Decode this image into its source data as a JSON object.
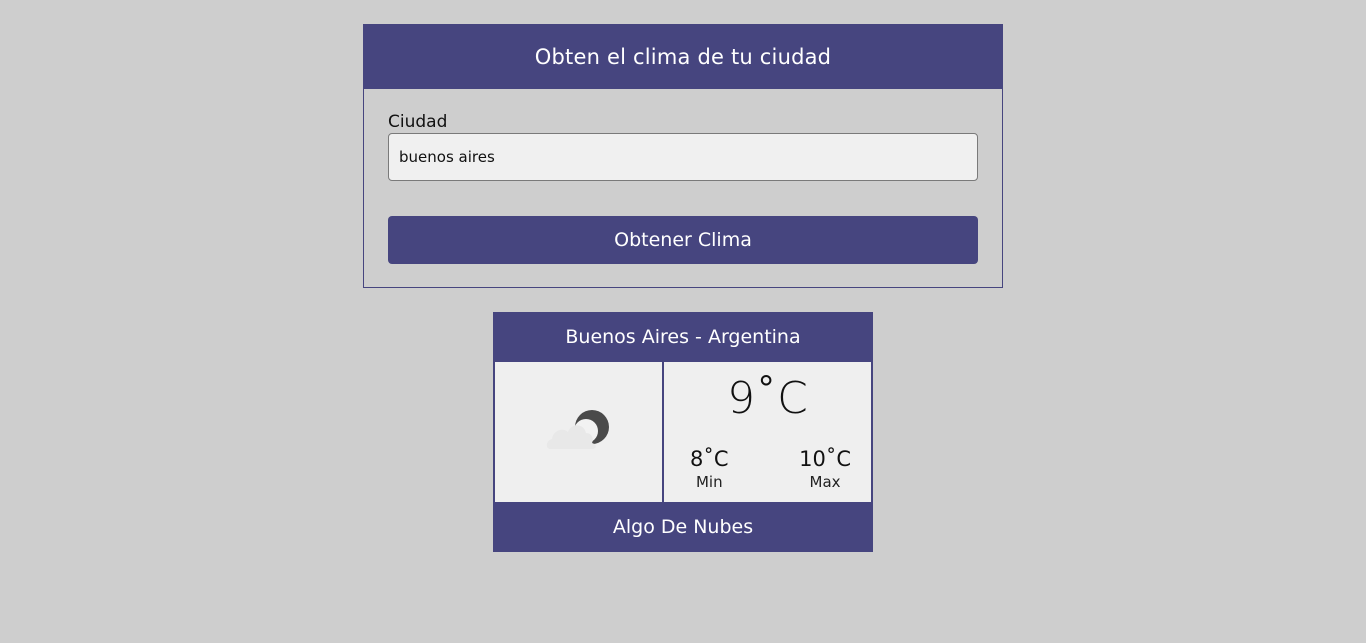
{
  "form": {
    "title": "Obten el clima de tu ciudad",
    "city_label": "Ciudad",
    "city_value": "buenos aires",
    "submit_label": "Obtener Clima"
  },
  "weather": {
    "location": "Buenos Aires - Argentina",
    "icon": "partly-cloudy-night-icon",
    "temperature": "9˚C",
    "min_value": "8˚C",
    "min_label": "Min",
    "max_value": "10˚C",
    "max_label": "Max",
    "description": "Algo De Nubes"
  },
  "colors": {
    "accent": "#46457f",
    "background": "#cecece",
    "panel": "#efefef"
  }
}
